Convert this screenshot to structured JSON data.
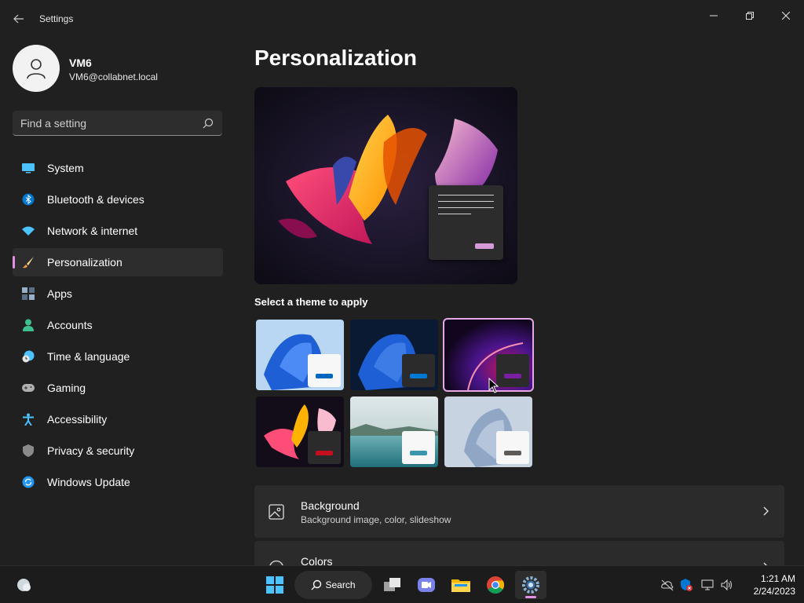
{
  "window": {
    "title": "Settings"
  },
  "user": {
    "name": "VM6",
    "email": "VM6@collabnet.local"
  },
  "search": {
    "placeholder": "Find a setting"
  },
  "sidebar": {
    "items": [
      {
        "label": "System",
        "icon": "system-icon",
        "active": false
      },
      {
        "label": "Bluetooth & devices",
        "icon": "bluetooth-icon",
        "active": false
      },
      {
        "label": "Network & internet",
        "icon": "wifi-icon",
        "active": false
      },
      {
        "label": "Personalization",
        "icon": "brush-icon",
        "active": true
      },
      {
        "label": "Apps",
        "icon": "apps-icon",
        "active": false
      },
      {
        "label": "Accounts",
        "icon": "person-icon",
        "active": false
      },
      {
        "label": "Time & language",
        "icon": "globe-clock-icon",
        "active": false
      },
      {
        "label": "Gaming",
        "icon": "gamepad-icon",
        "active": false
      },
      {
        "label": "Accessibility",
        "icon": "accessibility-icon",
        "active": false
      },
      {
        "label": "Privacy & security",
        "icon": "shield-icon",
        "active": false
      },
      {
        "label": "Windows Update",
        "icon": "update-icon",
        "active": false
      }
    ]
  },
  "main": {
    "title": "Personalization",
    "theme_heading": "Select a theme to apply",
    "themes": [
      {
        "name": "windows-light",
        "accent": "#0067c0",
        "selected": false
      },
      {
        "name": "windows-dark",
        "accent": "#0078d4",
        "selected": false
      },
      {
        "name": "glow",
        "accent": "#7b1fa2",
        "selected": true
      },
      {
        "name": "captured-motion",
        "accent": "#c50f1f",
        "selected": false
      },
      {
        "name": "sunrise",
        "accent": "#3a96ad",
        "selected": false
      },
      {
        "name": "flow",
        "accent": "#5d5a58",
        "selected": false
      }
    ],
    "cards": [
      {
        "title": "Background",
        "subtitle": "Background image, color, slideshow"
      },
      {
        "title": "Colors",
        "subtitle": ""
      }
    ]
  },
  "taskbar": {
    "search_label": "Search",
    "time": "1:21 AM",
    "date": "2/24/2023"
  },
  "colors": {
    "accent": "#e58ee5",
    "background": "#202020",
    "card": "#2b2b2b"
  }
}
